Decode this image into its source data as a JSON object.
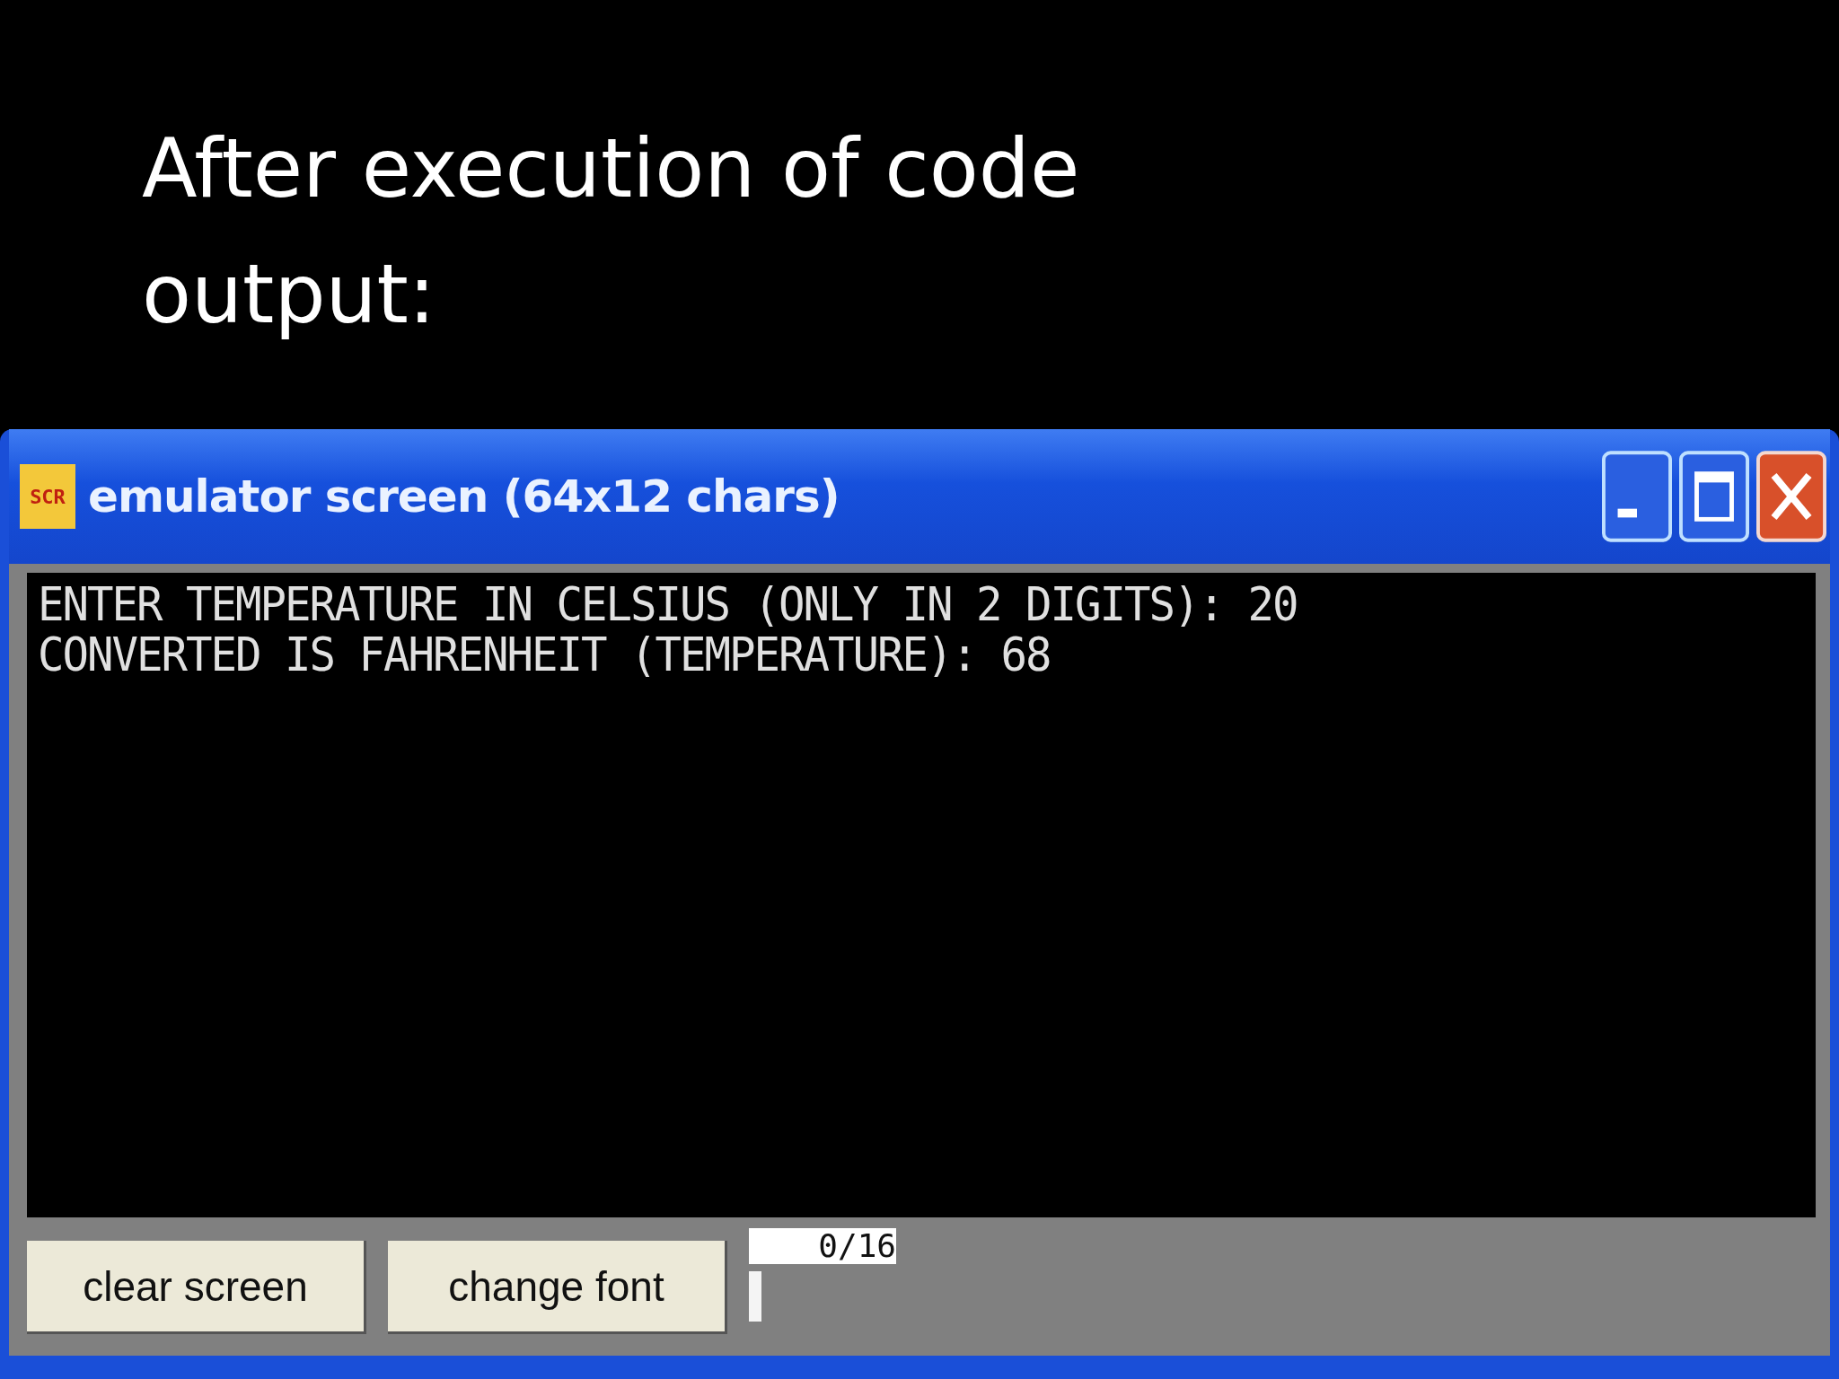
{
  "slide": {
    "title_lines": [
      "After execution of code",
      "output:"
    ]
  },
  "window": {
    "title": "emulator screen (64x12 chars)",
    "icon_text": "SCR"
  },
  "console": {
    "lines": [
      "ENTER TEMPERATURE IN CELSIUS (ONLY IN 2 DIGITS): 20",
      "CONVERTED IS FAHRENHEIT (TEMPERATURE): 68"
    ]
  },
  "buttons": [
    "clear screen",
    "change font"
  ],
  "counter": "0/16"
}
